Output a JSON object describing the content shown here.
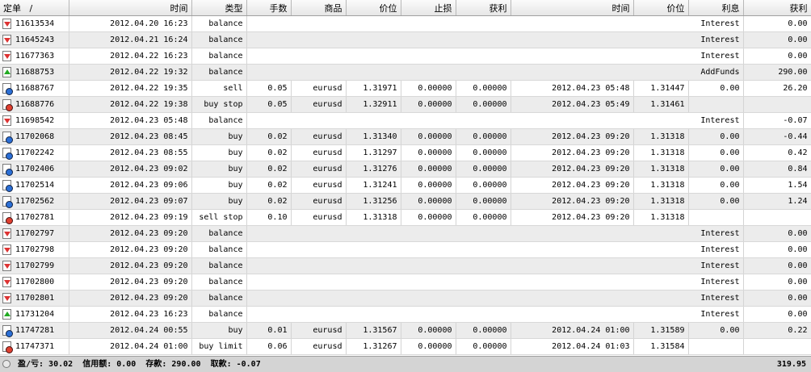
{
  "columns": {
    "ticket": "定单",
    "sort": "/",
    "open_time": "时间",
    "type": "类型",
    "lots": "手数",
    "symbol": "商品",
    "open_price": "价位",
    "sl": "止损",
    "tp": "获利",
    "close_time": "时间",
    "close_price": "价位",
    "swap": "利息",
    "profit": "获利"
  },
  "rows": [
    {
      "icon": "down",
      "ticket": "11613534",
      "open_time": "2012.04.20 16:23",
      "type": "balance",
      "comment": "Interest",
      "profit": "0.00"
    },
    {
      "icon": "down",
      "ticket": "11645243",
      "open_time": "2012.04.21 16:24",
      "type": "balance",
      "comment": "Interest",
      "profit": "0.00"
    },
    {
      "icon": "down",
      "ticket": "11677363",
      "open_time": "2012.04.22 16:23",
      "type": "balance",
      "comment": "Interest",
      "profit": "0.00"
    },
    {
      "icon": "up",
      "ticket": "11688753",
      "open_time": "2012.04.22 19:32",
      "type": "balance",
      "comment": "AddFunds",
      "profit": "290.00"
    },
    {
      "icon": "blue",
      "ticket": "11688767",
      "open_time": "2012.04.22 19:35",
      "type": "sell",
      "lots": "0.05",
      "symbol": "eurusd",
      "open_price": "1.31971",
      "sl": "0.00000",
      "tp": "0.00000",
      "close_time": "2012.04.23 05:48",
      "close_price": "1.31447",
      "swap": "0.00",
      "profit": "26.20"
    },
    {
      "icon": "red",
      "ticket": "11688776",
      "open_time": "2012.04.22 19:38",
      "type": "buy stop",
      "lots": "0.05",
      "symbol": "eurusd",
      "open_price": "1.32911",
      "sl": "0.00000",
      "tp": "0.00000",
      "close_time": "2012.04.23 05:49",
      "close_price": "1.31461",
      "swap": "",
      "profit": ""
    },
    {
      "icon": "down",
      "ticket": "11698542",
      "open_time": "2012.04.23 05:48",
      "type": "balance",
      "comment": "Interest",
      "profit": "-0.07"
    },
    {
      "icon": "blue",
      "ticket": "11702068",
      "open_time": "2012.04.23 08:45",
      "type": "buy",
      "lots": "0.02",
      "symbol": "eurusd",
      "open_price": "1.31340",
      "sl": "0.00000",
      "tp": "0.00000",
      "close_time": "2012.04.23 09:20",
      "close_price": "1.31318",
      "swap": "0.00",
      "profit": "-0.44"
    },
    {
      "icon": "blue",
      "ticket": "11702242",
      "open_time": "2012.04.23 08:55",
      "type": "buy",
      "lots": "0.02",
      "symbol": "eurusd",
      "open_price": "1.31297",
      "sl": "0.00000",
      "tp": "0.00000",
      "close_time": "2012.04.23 09:20",
      "close_price": "1.31318",
      "swap": "0.00",
      "profit": "0.42"
    },
    {
      "icon": "blue",
      "ticket": "11702406",
      "open_time": "2012.04.23 09:02",
      "type": "buy",
      "lots": "0.02",
      "symbol": "eurusd",
      "open_price": "1.31276",
      "sl": "0.00000",
      "tp": "0.00000",
      "close_time": "2012.04.23 09:20",
      "close_price": "1.31318",
      "swap": "0.00",
      "profit": "0.84"
    },
    {
      "icon": "blue",
      "ticket": "11702514",
      "open_time": "2012.04.23 09:06",
      "type": "buy",
      "lots": "0.02",
      "symbol": "eurusd",
      "open_price": "1.31241",
      "sl": "0.00000",
      "tp": "0.00000",
      "close_time": "2012.04.23 09:20",
      "close_price": "1.31318",
      "swap": "0.00",
      "profit": "1.54"
    },
    {
      "icon": "blue",
      "ticket": "11702562",
      "open_time": "2012.04.23 09:07",
      "type": "buy",
      "lots": "0.02",
      "symbol": "eurusd",
      "open_price": "1.31256",
      "sl": "0.00000",
      "tp": "0.00000",
      "close_time": "2012.04.23 09:20",
      "close_price": "1.31318",
      "swap": "0.00",
      "profit": "1.24"
    },
    {
      "icon": "red",
      "ticket": "11702781",
      "open_time": "2012.04.23 09:19",
      "type": "sell stop",
      "lots": "0.10",
      "symbol": "eurusd",
      "open_price": "1.31318",
      "sl": "0.00000",
      "tp": "0.00000",
      "close_time": "2012.04.23 09:20",
      "close_price": "1.31318",
      "swap": "",
      "profit": ""
    },
    {
      "icon": "down",
      "ticket": "11702797",
      "open_time": "2012.04.23 09:20",
      "type": "balance",
      "comment": "Interest",
      "profit": "0.00"
    },
    {
      "icon": "down",
      "ticket": "11702798",
      "open_time": "2012.04.23 09:20",
      "type": "balance",
      "comment": "Interest",
      "profit": "0.00"
    },
    {
      "icon": "down",
      "ticket": "11702799",
      "open_time": "2012.04.23 09:20",
      "type": "balance",
      "comment": "Interest",
      "profit": "0.00"
    },
    {
      "icon": "down",
      "ticket": "11702800",
      "open_time": "2012.04.23 09:20",
      "type": "balance",
      "comment": "Interest",
      "profit": "0.00"
    },
    {
      "icon": "down",
      "ticket": "11702801",
      "open_time": "2012.04.23 09:20",
      "type": "balance",
      "comment": "Interest",
      "profit": "0.00"
    },
    {
      "icon": "up",
      "ticket": "11731204",
      "open_time": "2012.04.23 16:23",
      "type": "balance",
      "comment": "Interest",
      "profit": "0.00"
    },
    {
      "icon": "blue",
      "ticket": "11747281",
      "open_time": "2012.04.24 00:55",
      "type": "buy",
      "lots": "0.01",
      "symbol": "eurusd",
      "open_price": "1.31567",
      "sl": "0.00000",
      "tp": "0.00000",
      "close_time": "2012.04.24 01:00",
      "close_price": "1.31589",
      "swap": "0.00",
      "profit": "0.22"
    },
    {
      "icon": "red",
      "ticket": "11747371",
      "open_time": "2012.04.24 01:00",
      "type": "buy limit",
      "lots": "0.06",
      "symbol": "eurusd",
      "open_price": "1.31267",
      "sl": "0.00000",
      "tp": "0.00000",
      "close_time": "2012.04.24 01:03",
      "close_price": "1.31584",
      "swap": "",
      "profit": ""
    }
  ],
  "footer": {
    "summary": "盈/亏: 30.02  信用额: 0.00  存款: 290.00  取款: -0.07",
    "total": "319.95"
  },
  "colors": {
    "alt_row": "#ececec",
    "footer": "#d4d4d4"
  }
}
